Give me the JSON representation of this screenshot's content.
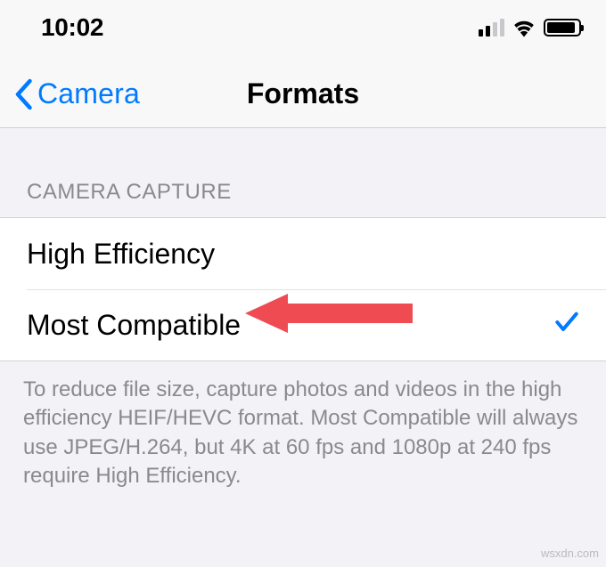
{
  "status": {
    "time": "10:02"
  },
  "nav": {
    "back_label": "Camera",
    "title": "Formats"
  },
  "section": {
    "header": "CAMERA CAPTURE"
  },
  "options": {
    "high_efficiency": "High Efficiency",
    "most_compatible": "Most Compatible"
  },
  "footer": {
    "text": "To reduce file size, capture photos and videos in the high efficiency HEIF/HEVC format. Most Compatible will always use JPEG/H.264, but 4K at 60 fps and 1080p at 240 fps require High Efficiency."
  },
  "watermark": "wsxdn.com"
}
